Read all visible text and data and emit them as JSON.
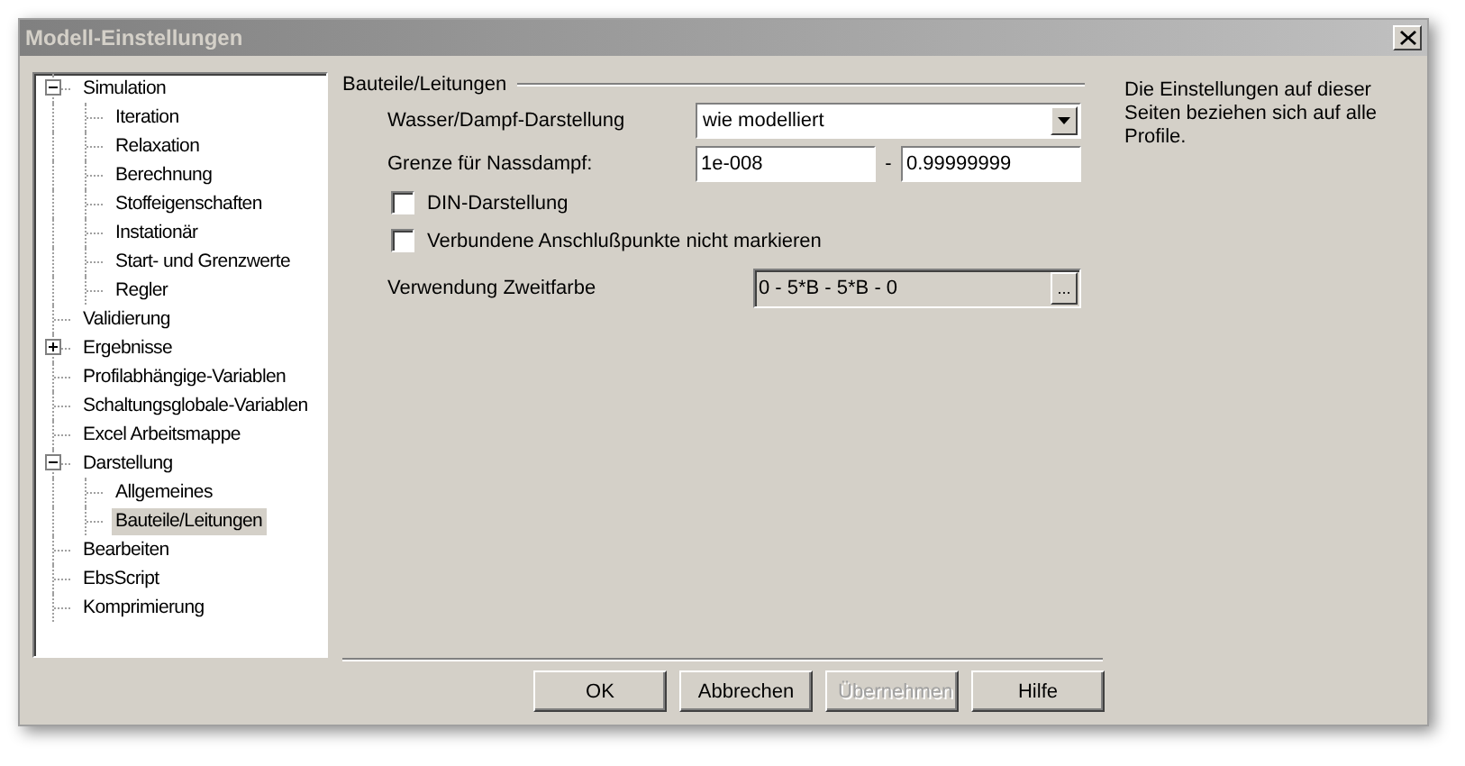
{
  "window": {
    "title": "Modell-Einstellungen"
  },
  "tree": [
    {
      "label": "Simulation",
      "selected": false,
      "expanded": true,
      "children": [
        {
          "label": "Iteration",
          "selected": false
        },
        {
          "label": "Relaxation",
          "selected": false
        },
        {
          "label": "Berechnung",
          "selected": false
        },
        {
          "label": "Stoffeigenschaften",
          "selected": false
        },
        {
          "label": "Instationär",
          "selected": false
        },
        {
          "label": "Start- und Grenzwerte",
          "selected": false
        },
        {
          "label": "Regler",
          "selected": false
        }
      ]
    },
    {
      "label": "Validierung",
      "selected": false
    },
    {
      "label": "Ergebnisse",
      "selected": false,
      "expanded": false
    },
    {
      "label": "Profilabhängige-Variablen",
      "selected": false
    },
    {
      "label": "Schaltungsglobale-Variablen",
      "selected": false
    },
    {
      "label": "Excel Arbeitsmappe",
      "selected": false
    },
    {
      "label": "Darstellung",
      "selected": false,
      "expanded": true,
      "children": [
        {
          "label": "Allgemeines",
          "selected": false
        },
        {
          "label": "Bauteile/Leitungen",
          "selected": true
        }
      ]
    },
    {
      "label": "Bearbeiten",
      "selected": false
    },
    {
      "label": "EbsScript",
      "selected": false
    },
    {
      "label": "Komprimierung",
      "selected": false
    }
  ],
  "group": {
    "title": "Bauteile/Leitungen"
  },
  "fields": [
    {
      "kind": "dropdown",
      "label": "Wasser/Dampf-Darstellung",
      "value": "wie modelliert"
    },
    {
      "kind": "range",
      "label": "Grenze für Nassdampf:",
      "from": "1e-008",
      "separator": "-",
      "to": "0.99999999"
    },
    {
      "kind": "checkbox",
      "label": "DIN-Darstellung",
      "checked": false
    },
    {
      "kind": "checkbox",
      "label": "Verbundene Anschlußpunkte nicht markieren",
      "checked": false
    },
    {
      "kind": "picker",
      "label": "Verwendung Zweitfarbe",
      "value": "0 - 5*B - 5*B - 0",
      "button": "..."
    }
  ],
  "note": "Die Einstellungen auf dieser Seiten beziehen sich auf alle Profile.",
  "buttons": [
    {
      "label": "OK",
      "disabled": false
    },
    {
      "label": "Abbrechen",
      "disabled": false
    },
    {
      "label": "Übernehmen",
      "disabled": true
    },
    {
      "label": "Hilfe",
      "disabled": false
    }
  ]
}
